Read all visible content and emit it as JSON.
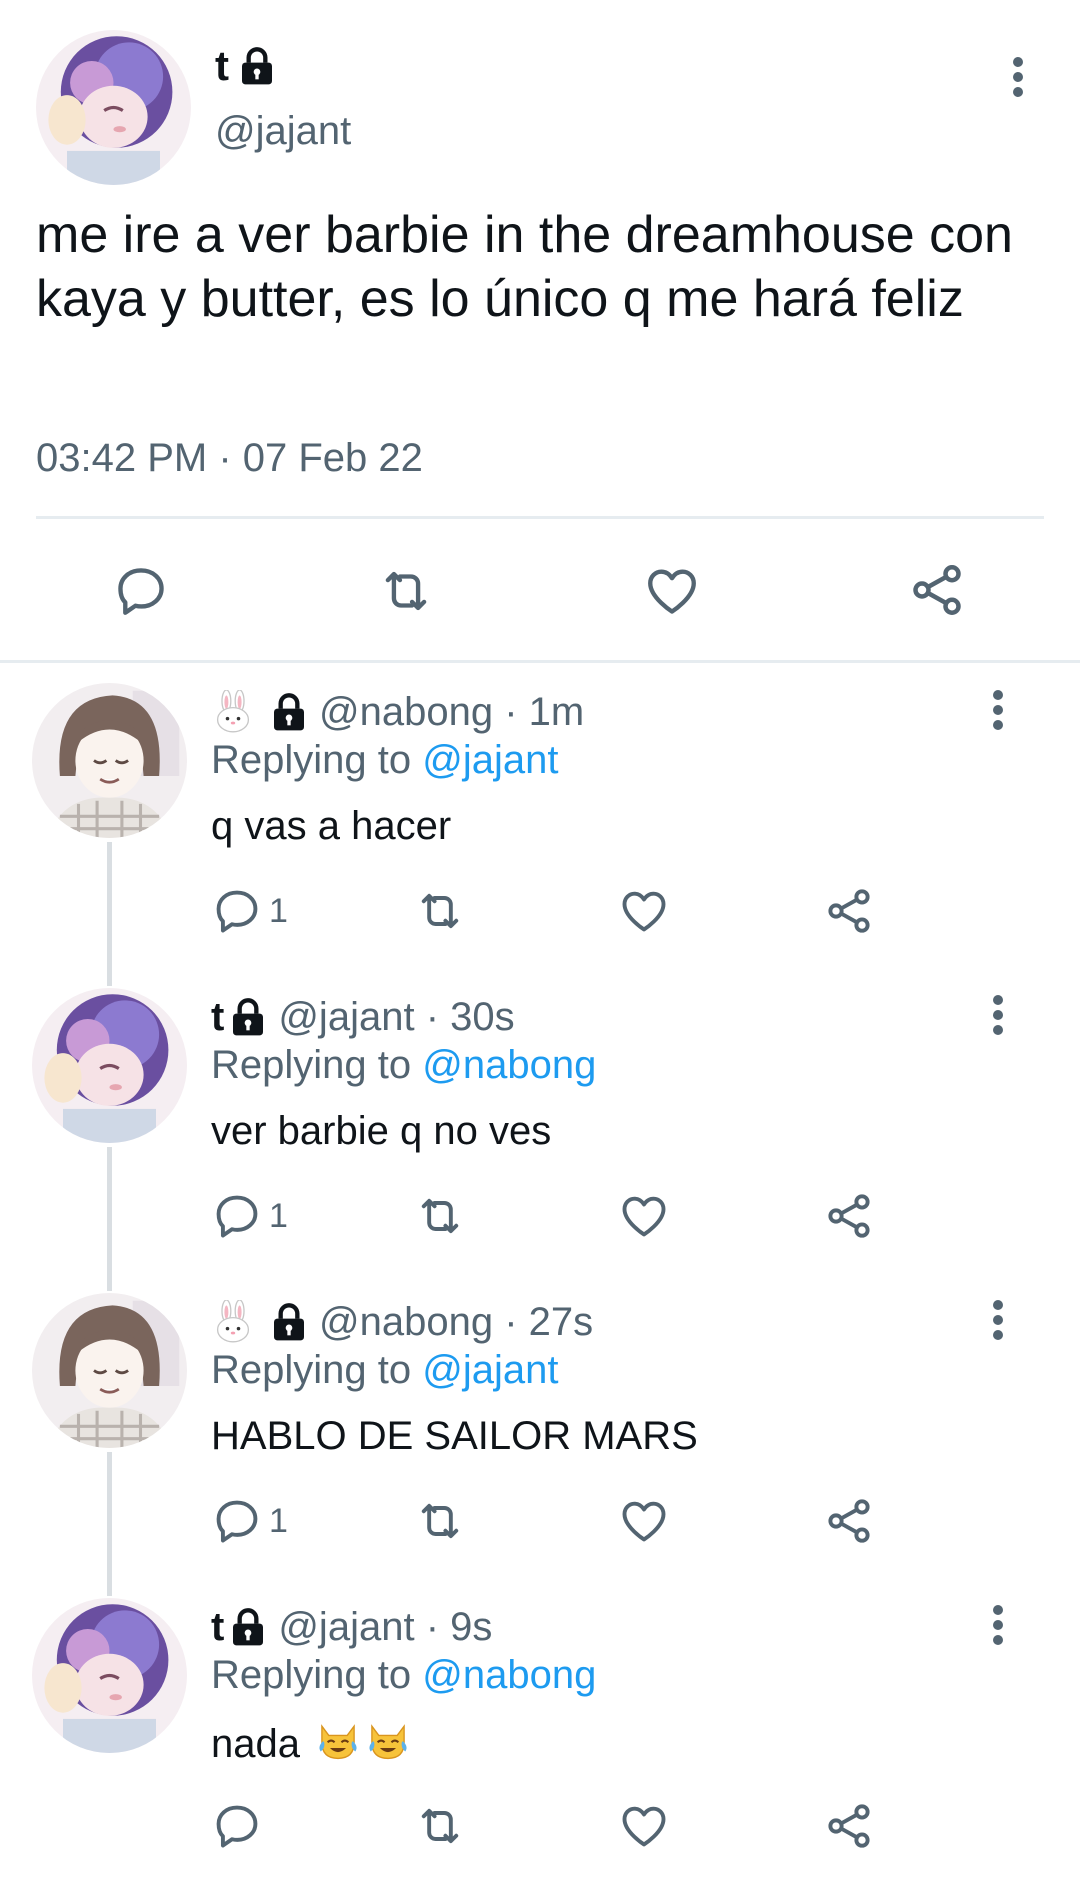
{
  "main": {
    "name": "t",
    "handle": "@jajant",
    "text": "me ire a ver barbie in the dreamhouse con kaya y butter, es lo único q me hará feliz",
    "timestamp": "03:42 PM · 07 Feb 22"
  },
  "replies": [
    {
      "name": "🐰",
      "handle": "@nabong",
      "time": "· 1m",
      "replying_label": "Replying to",
      "replying_to": "@jajant",
      "text": "q vas a hacer",
      "reply_count": "1"
    },
    {
      "name": "t",
      "handle": "@jajant",
      "time": "· 30s",
      "replying_label": "Replying to",
      "replying_to": "@nabong",
      "text": "ver barbie q no ves",
      "reply_count": "1"
    },
    {
      "name": "🐰",
      "handle": "@nabong",
      "time": "· 27s",
      "replying_label": "Replying to",
      "replying_to": "@jajant",
      "text": "HABLO DE SAILOR MARS",
      "reply_count": "1"
    },
    {
      "name": "t",
      "handle": "@jajant",
      "time": "· 9s",
      "replying_label": "Replying to",
      "replying_to": "@nabong",
      "text": "nada",
      "reply_count": ""
    }
  ],
  "icons": [
    "lock-icon",
    "more-icon",
    "reply-icon",
    "retweet-icon",
    "like-icon",
    "share-icon",
    "cat-joy-emoji"
  ],
  "colors": {
    "link": "#1d9bf0",
    "secondary": "#536471",
    "divider": "#e6ecf0",
    "text": "#0f1419"
  }
}
